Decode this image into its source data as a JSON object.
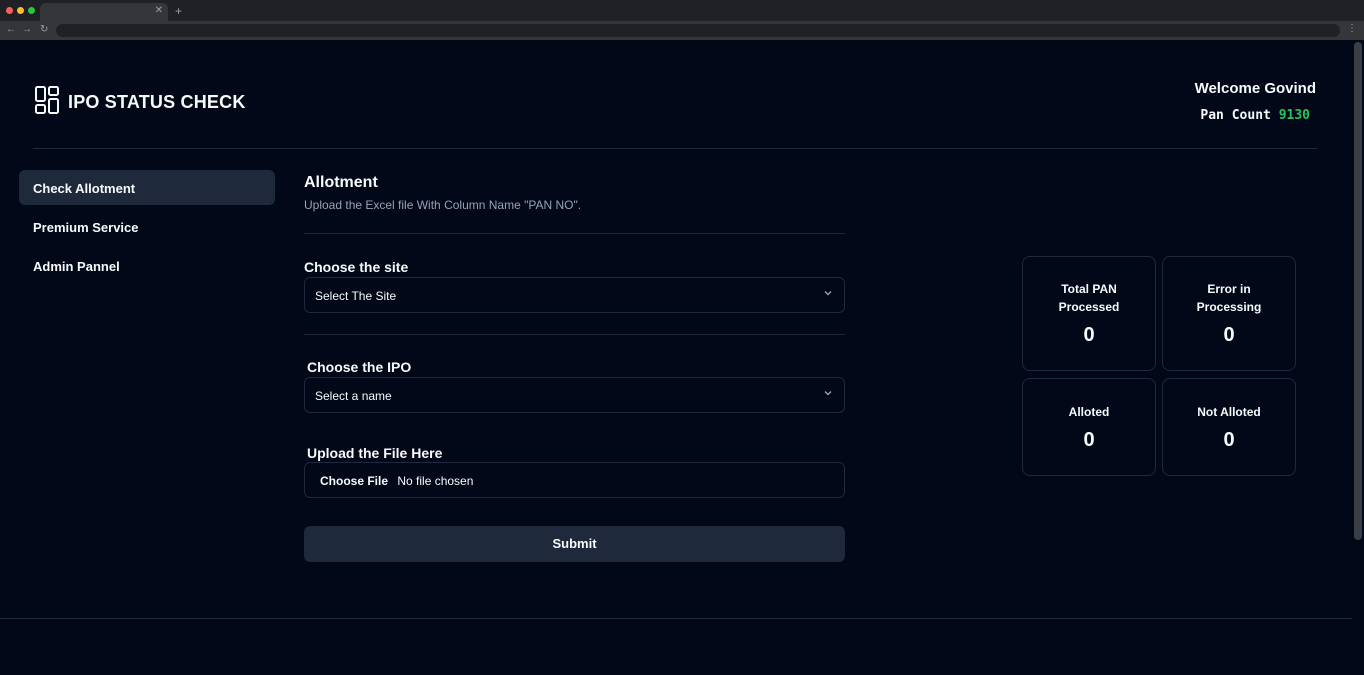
{
  "app": {
    "title": "IPO STATUS CHECK",
    "welcome": "Welcome Govind",
    "pan_count_label": "Pan Count",
    "pan_count_value": "9130"
  },
  "sidebar": {
    "items": [
      {
        "label": "Check Allotment",
        "active": true
      },
      {
        "label": "Premium Service",
        "active": false
      },
      {
        "label": "Admin Pannel",
        "active": false
      }
    ]
  },
  "main": {
    "heading": "Allotment",
    "subheading": "Upload the Excel file With Column Name \"PAN NO\".",
    "site_label": "Choose the site",
    "site_select_value": "Select The Site",
    "ipo_label": "Choose the IPO",
    "ipo_select_value": "Select a name",
    "upload_label": "Upload the File Here",
    "file_button": "Choose File",
    "file_status": "No file chosen",
    "submit_label": "Submit"
  },
  "stats": {
    "total_processed": {
      "label_line1": "Total PAN",
      "label_line2": "Processed",
      "value": "0"
    },
    "errors": {
      "label_line1": "Error in",
      "label_line2": "Processing",
      "value": "0"
    },
    "alloted": {
      "label": "Alloted",
      "value": "0"
    },
    "not_alloted": {
      "label": "Not Alloted",
      "value": "0"
    }
  },
  "icons": {
    "logo": "layout-dashboard-icon",
    "select_chevron": "chevron-down-icon"
  },
  "colors": {
    "background": "#020817",
    "surface": "#1e293b",
    "accent_green": "#22c55e",
    "muted_text": "#94a3b8"
  }
}
